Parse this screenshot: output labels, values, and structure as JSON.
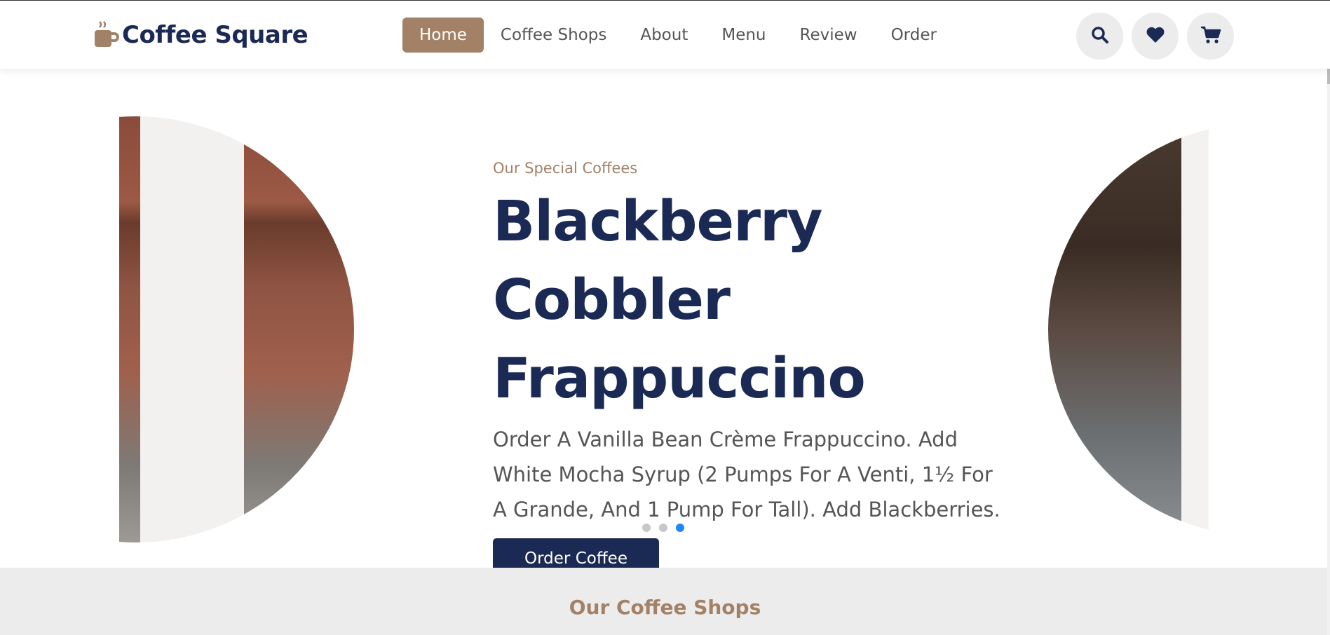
{
  "brand": {
    "name": "Coffee Square",
    "icon": "coffee-cup-icon",
    "color": "#a38166"
  },
  "nav": {
    "items": [
      {
        "label": "Home",
        "active": true
      },
      {
        "label": "Coffee Shops",
        "active": false
      },
      {
        "label": "About",
        "active": false
      },
      {
        "label": "Menu",
        "active": false
      },
      {
        "label": "Review",
        "active": false
      },
      {
        "label": "Order",
        "active": false
      }
    ]
  },
  "actions": [
    {
      "icon": "search-icon"
    },
    {
      "icon": "heart-icon"
    },
    {
      "icon": "cart-icon"
    }
  ],
  "hero": {
    "kicker": "Our Special Coffees",
    "title_line1": "Blackberry Cobbler",
    "title_line2": "Frappuccino",
    "desc_line1": "Order A Vanilla Bean Crème Frappuccino. Add",
    "desc_line2": "White Mocha Syrup (2 Pumps For A Venti, 1½ For",
    "desc_line3": "A Grande, And 1 Pump For Tall). Add Blackberries.",
    "cta": "Order Coffee",
    "slides": 3,
    "active_slide": 3
  },
  "shops": {
    "title": "Our Coffee Shops"
  },
  "colors": {
    "navy": "#1b2a55",
    "brown": "#a38166",
    "dot_active": "#1e88f5"
  }
}
